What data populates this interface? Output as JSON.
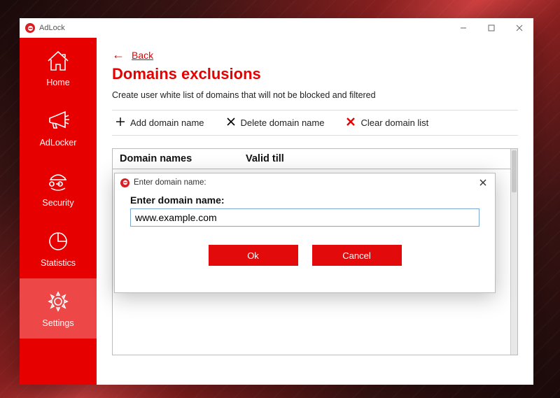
{
  "app": {
    "title": "AdLock"
  },
  "sidebar": {
    "items": [
      {
        "label": "Home"
      },
      {
        "label": "AdLocker"
      },
      {
        "label": "Security"
      },
      {
        "label": "Statistics"
      },
      {
        "label": "Settings"
      }
    ],
    "active_index": 4
  },
  "page": {
    "back_label": "Back",
    "title": "Domains exclusions",
    "description": "Create user white list of domains that will not be blocked and filtered"
  },
  "toolbar": {
    "add_label": "Add domain name",
    "delete_label": "Delete domain name",
    "clear_label": "Clear domain list"
  },
  "table": {
    "columns": [
      {
        "label": "Domain names"
      },
      {
        "label": "Valid till"
      }
    ],
    "rows": []
  },
  "dialog": {
    "title": "Enter domain name:",
    "label": "Enter domain name:",
    "input_value": "www.example.com",
    "ok_label": "Ok",
    "cancel_label": "Cancel"
  },
  "colors": {
    "accent": "#e60000"
  }
}
